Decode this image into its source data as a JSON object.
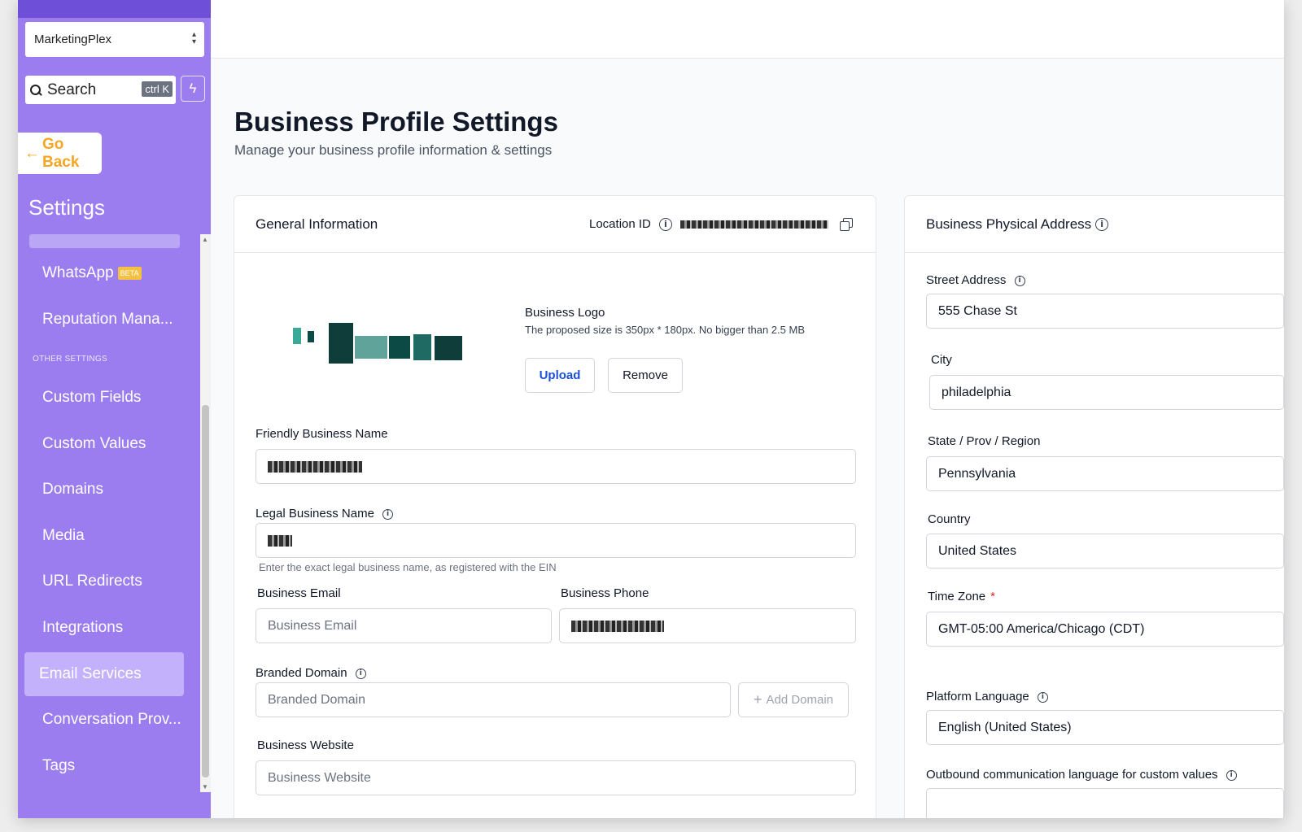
{
  "sidebar": {
    "account_name": "MarketingPlex",
    "search_label": "Search",
    "search_shortcut": "ctrl K",
    "go_back_label": "Go Back",
    "settings_title": "Settings",
    "whatsapp_label": "WhatsApp",
    "whatsapp_badge": "BETA",
    "reputation_label": "Reputation Mana...",
    "other_settings_label": "OTHER SETTINGS",
    "items": [
      {
        "label": "Custom Fields"
      },
      {
        "label": "Custom Values"
      },
      {
        "label": "Domains"
      },
      {
        "label": "Media"
      },
      {
        "label": "URL Redirects"
      },
      {
        "label": "Integrations"
      },
      {
        "label": "Email Services"
      },
      {
        "label": "Conversation Prov..."
      },
      {
        "label": "Tags"
      }
    ],
    "active_item": "Email Services"
  },
  "page": {
    "title": "Business Profile Settings",
    "subtitle": "Manage your business profile information & settings"
  },
  "general": {
    "title": "General Information",
    "location_id_label": "Location ID",
    "logo_title": "Business Logo",
    "logo_help": "The proposed size is 350px * 180px. No bigger than 2.5 MB",
    "upload_label": "Upload",
    "remove_label": "Remove",
    "friendly_name_label": "Friendly Business Name",
    "legal_name_label": "Legal Business Name",
    "legal_name_help": "Enter the exact legal business name, as registered with the EIN",
    "email_label": "Business Email",
    "email_placeholder": "Business Email",
    "phone_label": "Business Phone",
    "branded_domain_label": "Branded Domain",
    "branded_domain_placeholder": "Branded Domain",
    "add_domain_label": "Add Domain",
    "website_label": "Business Website",
    "website_placeholder": "Business Website"
  },
  "address": {
    "title": "Business Physical Address",
    "street_label": "Street Address",
    "street_value": "555 Chase St",
    "city_label": "City",
    "city_value": "philadelphia",
    "state_label": "State / Prov / Region",
    "state_value": "Pennsylvania",
    "country_label": "Country",
    "country_value": "United States",
    "timezone_label": "Time Zone",
    "timezone_value": "GMT-05:00 America/Chicago (CDT)",
    "platform_language_label": "Platform Language",
    "platform_language_value": "English (United States)",
    "outbound_language_label": "Outbound communication language for custom values"
  },
  "colors": {
    "sidebar": "#9b7df0",
    "accent": "#1d4ed8",
    "go_back": "#f5a623"
  }
}
